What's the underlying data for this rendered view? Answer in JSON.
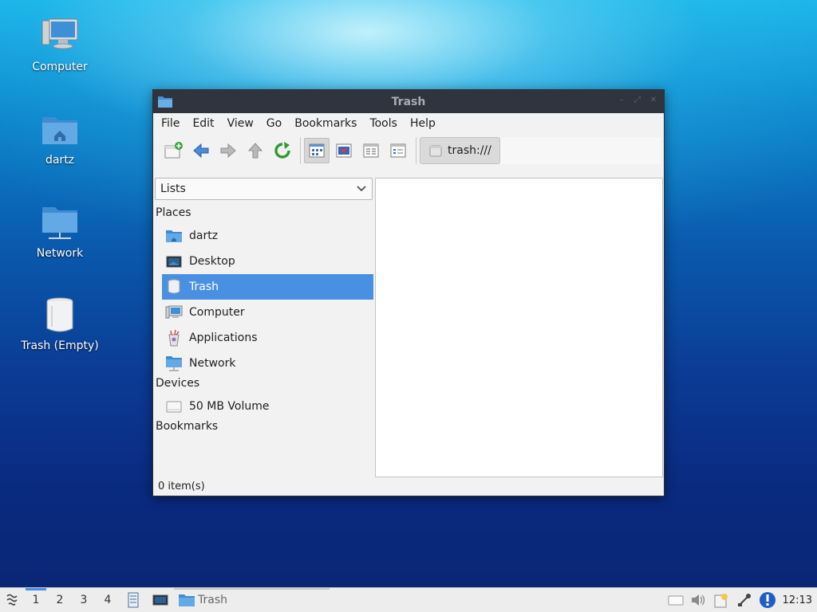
{
  "desktop": {
    "icons": [
      {
        "label": "Computer",
        "icon": "computer-icon"
      },
      {
        "label": "dartz",
        "icon": "home-folder-icon"
      },
      {
        "label": "Network",
        "icon": "network-folder-icon"
      },
      {
        "label": "Trash (Empty)",
        "icon": "trash-icon"
      }
    ]
  },
  "window": {
    "title": "Trash",
    "menu": [
      "File",
      "Edit",
      "View",
      "Go",
      "Bookmarks",
      "Tools",
      "Help"
    ],
    "toolbar": {
      "buttons": [
        "new-tab-icon",
        "back-arrow-icon",
        "forward-arrow-icon",
        "up-arrow-icon",
        "reload-icon",
        "icon-view-icon",
        "thumbnail-view-icon",
        "compact-view-icon",
        "detailed-view-icon"
      ],
      "location": "trash:///"
    },
    "sidebar": {
      "mode": "Lists",
      "sections": {
        "places": "Places",
        "devices": "Devices",
        "bookmarks": "Bookmarks"
      },
      "places": [
        "dartz",
        "Desktop",
        "Trash",
        "Computer",
        "Applications",
        "Network"
      ],
      "devices": [
        "50 MB Volume"
      ],
      "selected": "Trash"
    },
    "status": "0 item(s)"
  },
  "taskbar": {
    "workspaces": [
      "1",
      "2",
      "3",
      "4"
    ],
    "active_workspace": "1",
    "task": "Trash",
    "clock": "12:13"
  },
  "colors": {
    "accent": "#4a90e2",
    "titlebar": "#2f343f",
    "window_bg": "#f2f2f2"
  }
}
